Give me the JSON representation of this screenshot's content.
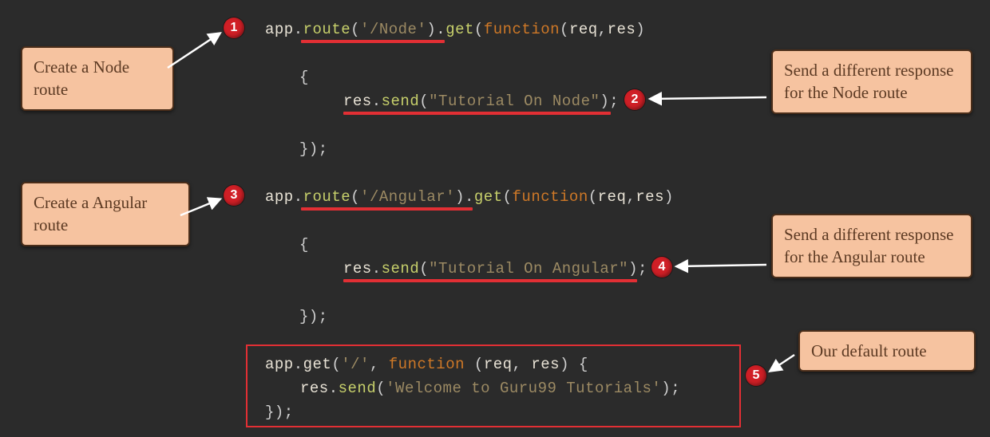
{
  "badges": {
    "b1": "1",
    "b2": "2",
    "b3": "3",
    "b4": "4",
    "b5": "5"
  },
  "callouts": {
    "c1": "Create a Node route",
    "c2": "Send a different response for the Node route",
    "c3": "Create a Angular route",
    "c4": "Send a different response for the Angular route",
    "c5": "Our default route"
  },
  "code": {
    "l1": {
      "app": "app",
      "dot": ".",
      "route": "route",
      "open": "(",
      "path": "'/Node'",
      "close": ")",
      "dot2": ".",
      "get": "get",
      "open2": "(",
      "fn": "function",
      "open3": "(",
      "req": "req",
      "comma": ",",
      "res": "res",
      "close3": ")"
    },
    "l2": {
      "brace": "{"
    },
    "l3": {
      "res": "res",
      "dot": ".",
      "send": "send",
      "open": "(",
      "str": "\"Tutorial On Node\"",
      "close": ")",
      "semi": ";"
    },
    "l4": {
      "close": "});"
    },
    "l5": {
      "app": "app",
      "dot": ".",
      "route": "route",
      "open": "(",
      "path": "'/Angular'",
      "close": ")",
      "dot2": ".",
      "get": "get",
      "open2": "(",
      "fn": "function",
      "open3": "(",
      "req": "req",
      "comma": ",",
      "res": "res",
      "close3": ")"
    },
    "l6": {
      "brace": "{"
    },
    "l7": {
      "res": "res",
      "dot": ".",
      "send": "send",
      "open": "(",
      "str": "\"Tutorial On Angular\"",
      "close": ")",
      "semi": ";"
    },
    "l8": {
      "close": "});"
    },
    "l9": {
      "app": "app",
      "dot": ".",
      "get": "get",
      "open": "(",
      "path": "'/'",
      "comma": ", ",
      "fn": "function",
      "sp": " ",
      "open2": "(",
      "req": "req",
      "comma2": ", ",
      "res": "res",
      "close2": ") ",
      "brace": "{"
    },
    "l10": {
      "res": "res",
      "dot": ".",
      "send": "send",
      "open": "(",
      "str": "'Welcome to Guru99 Tutorials'",
      "close": ")",
      "semi": ";"
    },
    "l11": {
      "close": "});"
    }
  }
}
